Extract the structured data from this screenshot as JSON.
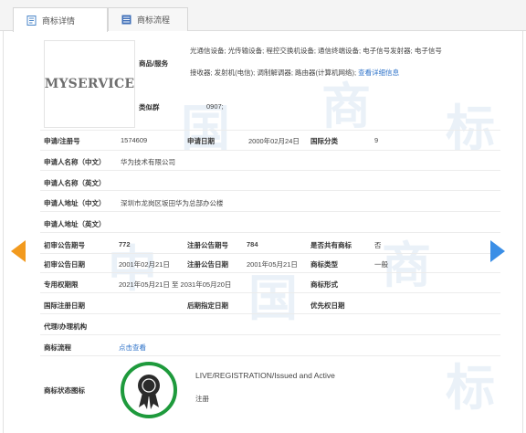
{
  "tabs": [
    {
      "label": "商标详情",
      "icon": "document-icon"
    },
    {
      "label": "商标流程",
      "icon": "list-icon"
    }
  ],
  "trademark": {
    "image_text": "MYSERVICE"
  },
  "goods": {
    "label": "商品/服务",
    "line1": "光通信设备; 光传输设备; 程控交换机设备; 通信终端设备; 电子信号发射器; 电子信号",
    "line2_prefix": "接收器; 发射机(电信); 调制解调器; 路由器(计算机网络);",
    "detail_link": "查看详细信息"
  },
  "similar_group": {
    "label": "类似群",
    "value": "0907;"
  },
  "fields": {
    "app_no_label": "申请/注册号",
    "app_no": "1574609",
    "app_date_label": "申请日期",
    "app_date": "2000年02月24日",
    "class_label": "国际分类",
    "class": "9",
    "applicant_cn_label": "申请人名称（中文）",
    "applicant_cn": "华为技术有限公司",
    "applicant_en_label": "申请人名称（英文）",
    "address_cn_label": "申请人地址（中文）",
    "address_cn": "深圳市龙岗区坂田华为总部办公楼",
    "address_en_label": "申请人地址（英文）",
    "prelim_no_label": "初审公告期号",
    "prelim_no": "772",
    "reg_no_label": "注册公告期号",
    "reg_no": "784",
    "shared_label": "是否共有商标",
    "shared": "否",
    "prelim_date_label": "初审公告日期",
    "prelim_date": "2001年02月21日",
    "reg_date_label": "注册公告日期",
    "reg_date": "2001年05月21日",
    "type_label": "商标类型",
    "type": "一般",
    "exclusive_label": "专用权期限",
    "exclusive": "2021年05月21日 至 2031年05月20日",
    "form_label": "商标形式",
    "intl_reg_label": "国际注册日期",
    "later_label": "后期指定日期",
    "priority_label": "优先权日期",
    "agent_label": "代理/办理机构",
    "process_label": "商标流程",
    "process_link": "点击查看",
    "status_label": "商标状态图标",
    "status_en": "LIVE/REGISTRATION/Issued and Active",
    "status_cn": "注册"
  },
  "colors": {
    "link": "#2f73c9",
    "badge_ring": "#1e9a3c",
    "arrow_left": "#f29a1e",
    "arrow_right": "#3a8ee6"
  }
}
